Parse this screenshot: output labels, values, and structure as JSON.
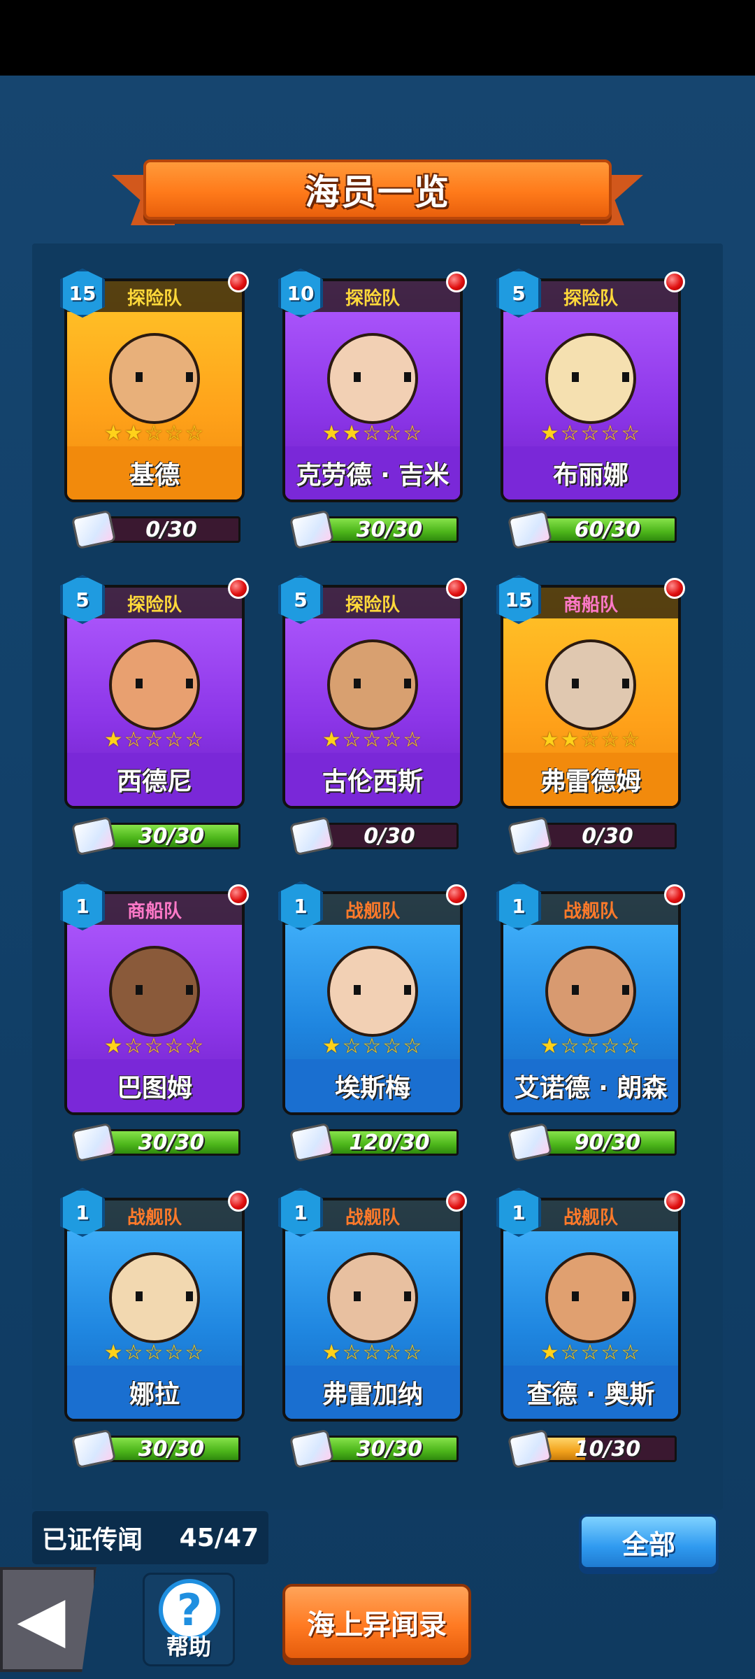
{
  "title": "海员一览",
  "cards": [
    {
      "level": "15",
      "team": "探险队",
      "team_class": "t-explore",
      "name": "基德",
      "stars": "★★☆☆☆",
      "progress": "0/30",
      "fill": 0.0,
      "bg": "bg-orange",
      "nbg": "n-orange",
      "head": "#e8b07a"
    },
    {
      "level": "10",
      "team": "探险队",
      "team_class": "t-explore",
      "name": "克劳德 · 吉米",
      "stars": "★★☆☆☆",
      "progress": "30/30",
      "fill": 1.0,
      "bg": "bg-purple",
      "nbg": "n-purple",
      "head": "#f2d0b4"
    },
    {
      "level": "5",
      "team": "探险队",
      "team_class": "t-explore",
      "name": "布丽娜",
      "stars": "★☆☆☆☆",
      "progress": "60/30",
      "fill": 1.0,
      "bg": "bg-purple",
      "nbg": "n-purple",
      "head": "#f5e0b0"
    },
    {
      "level": "5",
      "team": "探险队",
      "team_class": "t-explore",
      "name": "西德尼",
      "stars": "★☆☆☆☆",
      "progress": "30/30",
      "fill": 1.0,
      "bg": "bg-purple",
      "nbg": "n-purple",
      "head": "#e8a070"
    },
    {
      "level": "5",
      "team": "探险队",
      "team_class": "t-explore",
      "name": "古伦西斯",
      "stars": "★☆☆☆☆",
      "progress": "0/30",
      "fill": 0.0,
      "bg": "bg-purple",
      "nbg": "n-purple",
      "head": "#d8a070"
    },
    {
      "level": "15",
      "team": "商船队",
      "team_class": "t-merchant",
      "name": "弗雷德姆",
      "stars": "★★☆☆☆",
      "progress": "0/30",
      "fill": 0.0,
      "bg": "bg-orange",
      "nbg": "n-orange",
      "head": "#e0c8b0"
    },
    {
      "level": "1",
      "team": "商船队",
      "team_class": "t-merchant",
      "name": "巴图姆",
      "stars": "★☆☆☆☆",
      "progress": "30/30",
      "fill": 1.0,
      "bg": "bg-purple",
      "nbg": "n-purple",
      "head": "#8a5a3a"
    },
    {
      "level": "1",
      "team": "战舰队",
      "team_class": "t-warship",
      "name": "埃斯梅",
      "stars": "★☆☆☆☆",
      "progress": "120/30",
      "fill": 1.0,
      "bg": "bg-blue",
      "nbg": "n-blue",
      "head": "#f2d0b4"
    },
    {
      "level": "1",
      "team": "战舰队",
      "team_class": "t-warship",
      "name": "艾诺德 · 朗森",
      "stars": "★☆☆☆☆",
      "progress": "90/30",
      "fill": 1.0,
      "bg": "bg-blue",
      "nbg": "n-blue",
      "head": "#d89a70"
    },
    {
      "level": "1",
      "team": "战舰队",
      "team_class": "t-warship",
      "name": "娜拉",
      "stars": "★☆☆☆☆",
      "progress": "30/30",
      "fill": 1.0,
      "bg": "bg-blue",
      "nbg": "n-blue",
      "head": "#f2d8b0"
    },
    {
      "level": "1",
      "team": "战舰队",
      "team_class": "t-warship",
      "name": "弗雷加纳",
      "stars": "★☆☆☆☆",
      "progress": "30/30",
      "fill": 1.0,
      "bg": "bg-blue",
      "nbg": "n-blue",
      "head": "#e8c0a0"
    },
    {
      "level": "1",
      "team": "战舰队",
      "team_class": "t-warship",
      "name": "查德 · 奥斯",
      "stars": "★☆☆☆☆",
      "progress": "10/30",
      "fill": 0.333,
      "bg": "bg-blue",
      "nbg": "n-blue",
      "head": "#e0a070",
      "low": true
    }
  ],
  "footer": {
    "proof_label": "已证传闻",
    "proof_count": "45/47",
    "all_button": "全部",
    "help_label": "帮助",
    "records_button": "海上异闻录",
    "back_icon": "back-arrow-icon"
  }
}
